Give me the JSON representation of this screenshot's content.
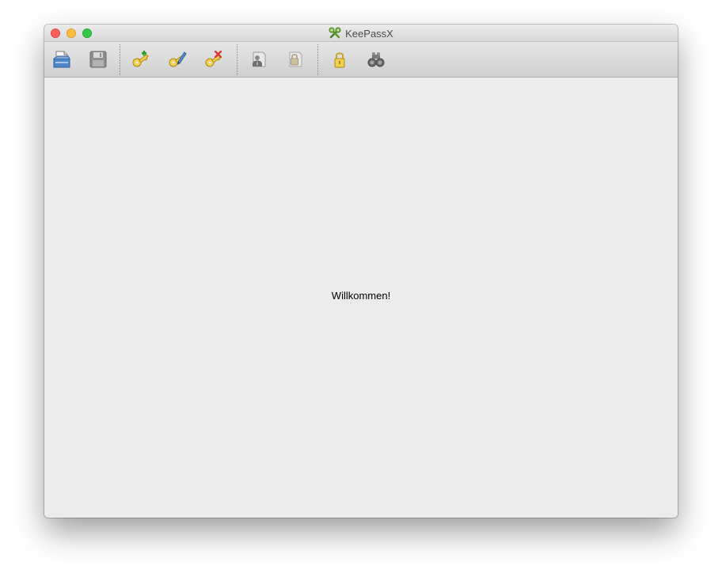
{
  "window": {
    "title": "KeePassX",
    "app_icon": "keepassx-app-icon"
  },
  "toolbar": {
    "items": [
      {
        "name": "open-database-button",
        "icon": "open-database-icon",
        "enabled": true
      },
      {
        "name": "save-database-button",
        "icon": "save-floppy-icon",
        "enabled": false
      },
      {
        "name": "add-entry-button",
        "icon": "key-add-icon",
        "enabled": true
      },
      {
        "name": "edit-entry-button",
        "icon": "key-edit-icon",
        "enabled": true
      },
      {
        "name": "delete-entry-button",
        "icon": "key-delete-icon",
        "enabled": true
      },
      {
        "name": "copy-username-button",
        "icon": "copy-username-icon",
        "enabled": false
      },
      {
        "name": "copy-password-button",
        "icon": "copy-password-icon",
        "enabled": false
      },
      {
        "name": "lock-database-button",
        "icon": "lock-icon",
        "enabled": true
      },
      {
        "name": "search-button",
        "icon": "binoculars-icon",
        "enabled": false
      }
    ]
  },
  "content": {
    "welcome_text": "Willkommen!"
  },
  "colors": {
    "close": "#fc605c",
    "minimize": "#fdbc40",
    "maximize": "#34c84a",
    "content_bg": "#ececec"
  }
}
